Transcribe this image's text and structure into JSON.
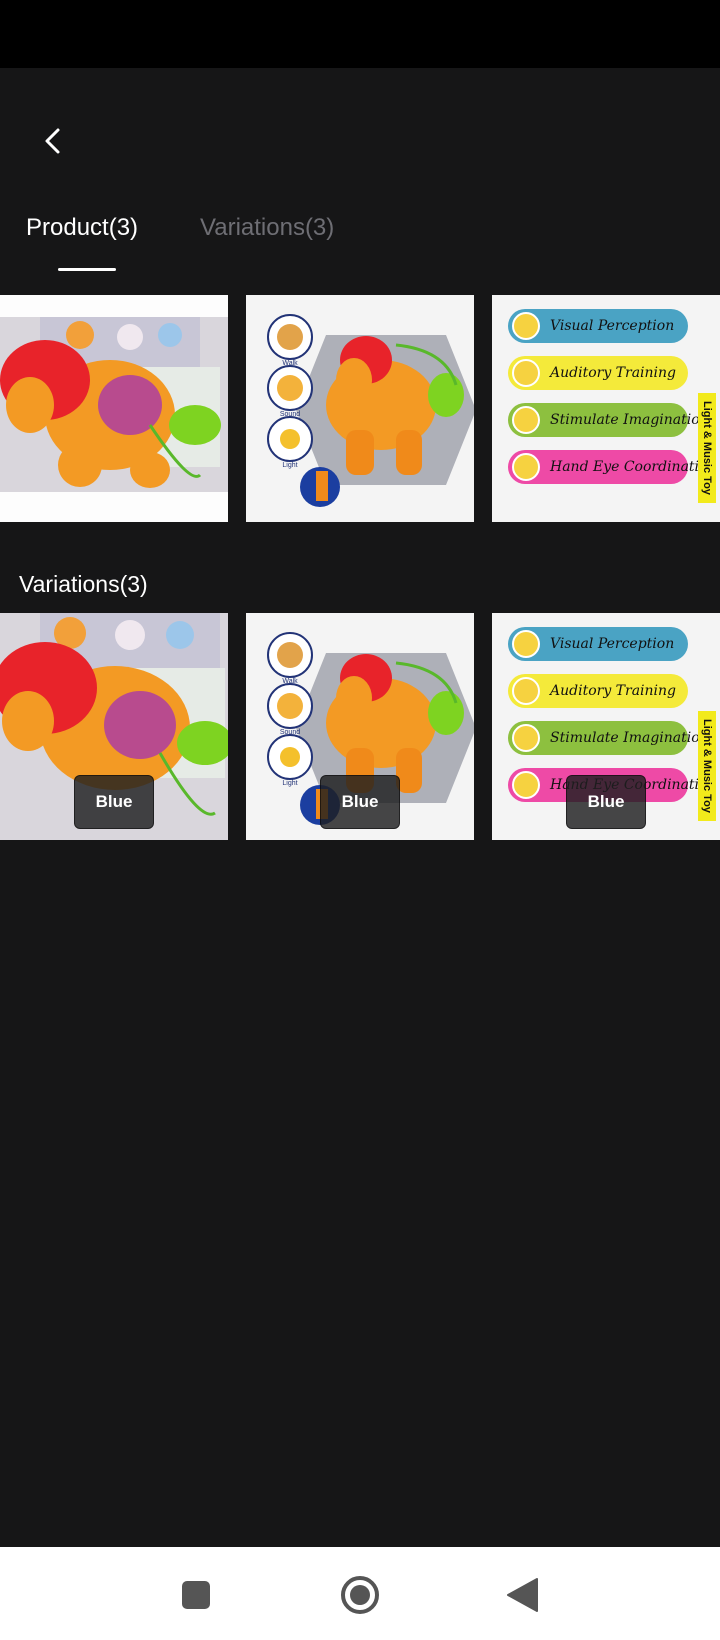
{
  "header": {
    "back_icon": "chevron-left-icon"
  },
  "tabs": [
    {
      "label": "Product(3)",
      "active": true
    },
    {
      "label": "Variations(3)",
      "active": false
    }
  ],
  "product_images": [
    {
      "alt": "horse-toy-box-photo"
    },
    {
      "alt": "horse-toy-features-walk-sound-light"
    },
    {
      "alt": "horse-toy-benefits-list"
    }
  ],
  "variations": {
    "title": "Variations(3)",
    "items": [
      {
        "label": "Blue"
      },
      {
        "label": "Blue"
      },
      {
        "label": "Blue"
      }
    ]
  },
  "feature_icons": [
    "Walk",
    "Sound",
    "Light"
  ],
  "benefits": [
    {
      "label": "Visual Perception",
      "color": "#4aa3c4"
    },
    {
      "label": "Auditory Training",
      "color": "#f4ea3a"
    },
    {
      "label": "Stimulate Imagination",
      "color": "#8dc03f"
    },
    {
      "label": "Hand Eye Coordination",
      "color": "#ee4aa6"
    }
  ],
  "benefits_side_label": "Light & Music Toy",
  "navbar": {
    "recent_icon": "square-icon",
    "home_icon": "circle-home-icon",
    "back_icon": "triangle-back-icon"
  },
  "colors": {
    "background": "#161617",
    "status_bar": "#000000",
    "tab_inactive": "#6e6e74",
    "horse_orange": "#f39a24",
    "horse_red": "#e8232a"
  }
}
